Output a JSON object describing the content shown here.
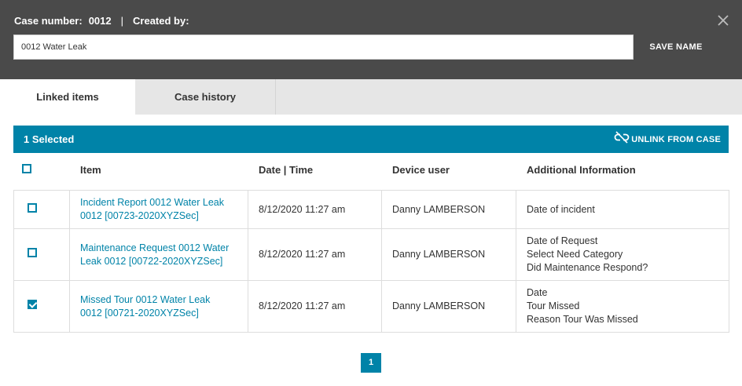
{
  "header": {
    "case_label": "Case number:",
    "case_number": "0012",
    "separator": "|",
    "created_label": "Created by:",
    "name_value": "0012 Water Leak",
    "save_label": "SAVE NAME"
  },
  "tabs": [
    {
      "label": "Linked items"
    },
    {
      "label": "Case history"
    }
  ],
  "selection": {
    "count_text": "1 Selected",
    "unlink_label": "UNLINK FROM CASE"
  },
  "table": {
    "headers": {
      "item": "Item",
      "datetime": "Date | Time",
      "device_user": "Device user",
      "additional": "Additional Information"
    },
    "rows": [
      {
        "checked": false,
        "item_line1": "Incident Report 0012 Water Leak",
        "item_line2": "0012 [00723-2020XYZSec]",
        "datetime": "8/12/2020 11:27 am",
        "device_user": "Danny LAMBERSON",
        "info": [
          "Date of incident"
        ]
      },
      {
        "checked": false,
        "item_line1": "Maintenance Request 0012 Water",
        "item_line2": "Leak 0012 [00722-2020XYZSec]",
        "datetime": "8/12/2020 11:27 am",
        "device_user": "Danny LAMBERSON",
        "info": [
          "Date of Request",
          "Select Need Category",
          "Did Maintenance Respond?"
        ]
      },
      {
        "checked": true,
        "item_line1": "Missed Tour 0012 Water Leak",
        "item_line2": "0012 [00721-2020XYZSec]",
        "datetime": "8/12/2020 11:27 am",
        "device_user": "Danny LAMBERSON",
        "info": [
          "Date",
          "Tour Missed",
          "Reason Tour Was Missed"
        ]
      }
    ]
  },
  "pagination": {
    "current_page": "1"
  },
  "colors": {
    "header_bg": "#4a4a4a",
    "accent": "#0083a8",
    "tab_bar": "#e6e6e6"
  }
}
